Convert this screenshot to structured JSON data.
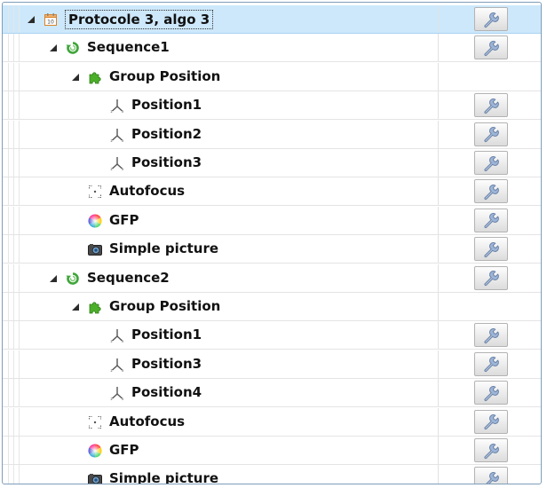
{
  "tree": {
    "rows": [
      {
        "label": "Protocole 3, algo 3",
        "level": 0,
        "icon": "calendar-icon",
        "expander": true,
        "selected": true,
        "wrench": true
      },
      {
        "label": "Sequence1",
        "level": 1,
        "icon": "sequence-loop-icon",
        "expander": true,
        "selected": false,
        "wrench": true
      },
      {
        "label": "Group Position",
        "level": 2,
        "icon": "puzzle-piece-icon",
        "expander": true,
        "selected": false,
        "wrench": false
      },
      {
        "label": "Position1",
        "level": 3,
        "icon": "xyz-axis-icon",
        "expander": false,
        "selected": false,
        "wrench": true
      },
      {
        "label": "Position2",
        "level": 3,
        "icon": "xyz-axis-icon",
        "expander": false,
        "selected": false,
        "wrench": true
      },
      {
        "label": "Position3",
        "level": 3,
        "icon": "xyz-axis-icon",
        "expander": false,
        "selected": false,
        "wrench": true
      },
      {
        "label": "Autofocus",
        "level": 2,
        "icon": "autofocus-icon",
        "expander": false,
        "selected": false,
        "wrench": true
      },
      {
        "label": "GFP",
        "level": 2,
        "icon": "color-wheel-icon",
        "expander": false,
        "selected": false,
        "wrench": true
      },
      {
        "label": "Simple picture",
        "level": 2,
        "icon": "camera-icon",
        "expander": false,
        "selected": false,
        "wrench": true
      },
      {
        "label": "Sequence2",
        "level": 1,
        "icon": "sequence-loop-icon",
        "expander": true,
        "selected": false,
        "wrench": true
      },
      {
        "label": "Group Position",
        "level": 2,
        "icon": "puzzle-piece-icon",
        "expander": true,
        "selected": false,
        "wrench": false
      },
      {
        "label": "Position1",
        "level": 3,
        "icon": "xyz-axis-icon",
        "expander": false,
        "selected": false,
        "wrench": true
      },
      {
        "label": "Position3",
        "level": 3,
        "icon": "xyz-axis-icon",
        "expander": false,
        "selected": false,
        "wrench": true
      },
      {
        "label": "Position4",
        "level": 3,
        "icon": "xyz-axis-icon",
        "expander": false,
        "selected": false,
        "wrench": true
      },
      {
        "label": "Autofocus",
        "level": 2,
        "icon": "autofocus-icon",
        "expander": false,
        "selected": false,
        "wrench": true
      },
      {
        "label": "GFP",
        "level": 2,
        "icon": "color-wheel-icon",
        "expander": false,
        "selected": false,
        "wrench": true
      },
      {
        "label": "Simple picture",
        "level": 2,
        "icon": "camera-icon",
        "expander": false,
        "selected": false,
        "wrench": true
      }
    ]
  },
  "colors": {
    "selected_bg": "#cde8fb",
    "sequence_green": "#3fa53a",
    "puzzle_green": "#4caf2a",
    "border": "#7f9db9"
  }
}
